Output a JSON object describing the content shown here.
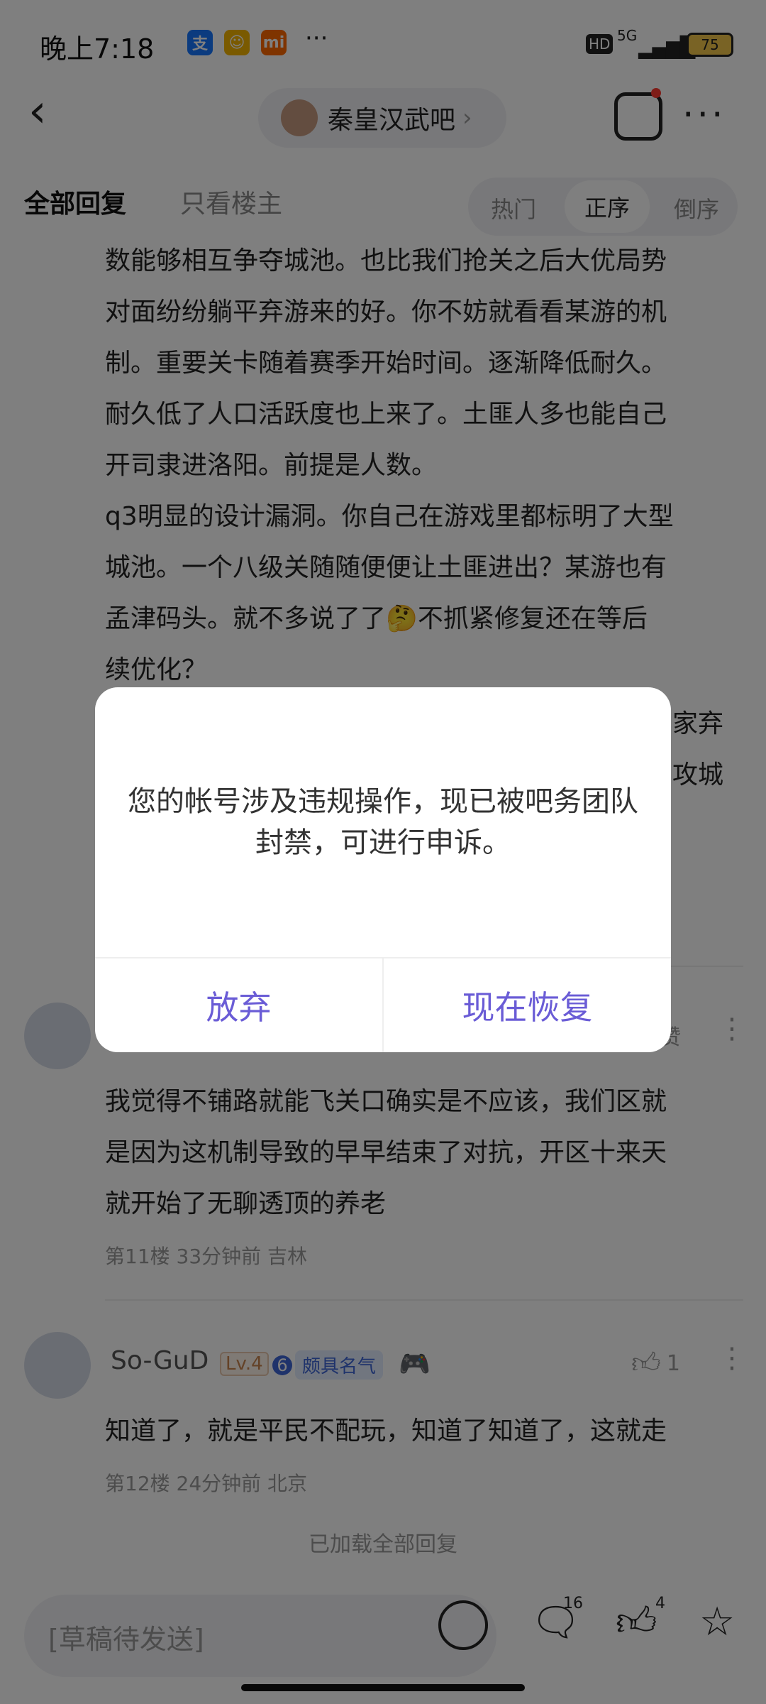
{
  "status_bar": {
    "time": "晚上7:18",
    "app_icons": [
      "alipay-icon",
      "game-icon",
      "mi-icon"
    ],
    "more": "···",
    "hd": "HD",
    "network": "5G",
    "battery": "75",
    "battery_color": "#f3c74a"
  },
  "header": {
    "forum_name": "秦皇汉武吧",
    "forum_chevron": "›",
    "back": "‹",
    "more": "···"
  },
  "tabs": {
    "all_replies": "全部回复",
    "only_op": "只看楼主",
    "sort": [
      "热门",
      "正序",
      "倒序"
    ]
  },
  "post_continued": {
    "lines": [
      "数能够相互争夺城池。也比我们抢关之后大优局势",
      "对面纷纷躺平弃游来的好。你不妨就看看某游的机",
      "制。重要关卡随着赛季开始时间。逐渐降低耐久。",
      "耐久低了人口活跃度也上来了。土匪人多也能自己",
      "开司隶进洛阳。前提是人数。",
      "q3明显的设计漏洞。你自己在游戏里都标明了大型",
      "城池。一个八级关随随便便让土匪进出？某游也有",
      "孟津码头。就不多说了了🤔不抓紧修复还在等后",
      "续优化？"
    ],
    "partial_right": [
      "家弃",
      "攻城"
    ]
  },
  "reply_11": {
    "partial_like": "赞",
    "lines": [
      "我觉得不铺路就能飞关口确实是不应该，我们区就",
      "是因为这机制导致的早早结束了对抗，开区十来天",
      "就开始了无聊透顶的养老"
    ],
    "meta": "第11楼   33分钟前   吉林"
  },
  "reply_12": {
    "username": "So-GuD",
    "level": "Lv.4",
    "badge_num": "6",
    "badge_text": "颇具名气",
    "likes": "1",
    "text": "知道了，就是平民不配玩，知道了知道了，这就走",
    "meta": "第12楼   24分钟前   北京"
  },
  "footer_note": "已加载全部回复",
  "bottom_bar": {
    "placeholder": "[草稿待发送]",
    "comment_count": "16",
    "like_count": "4"
  },
  "dialog": {
    "message": "您的帐号涉及违规操作，现已被吧务团队封禁，可进行申诉。",
    "cancel": "放弃",
    "confirm": "现在恢复",
    "button_color": "#6a5cd6"
  }
}
